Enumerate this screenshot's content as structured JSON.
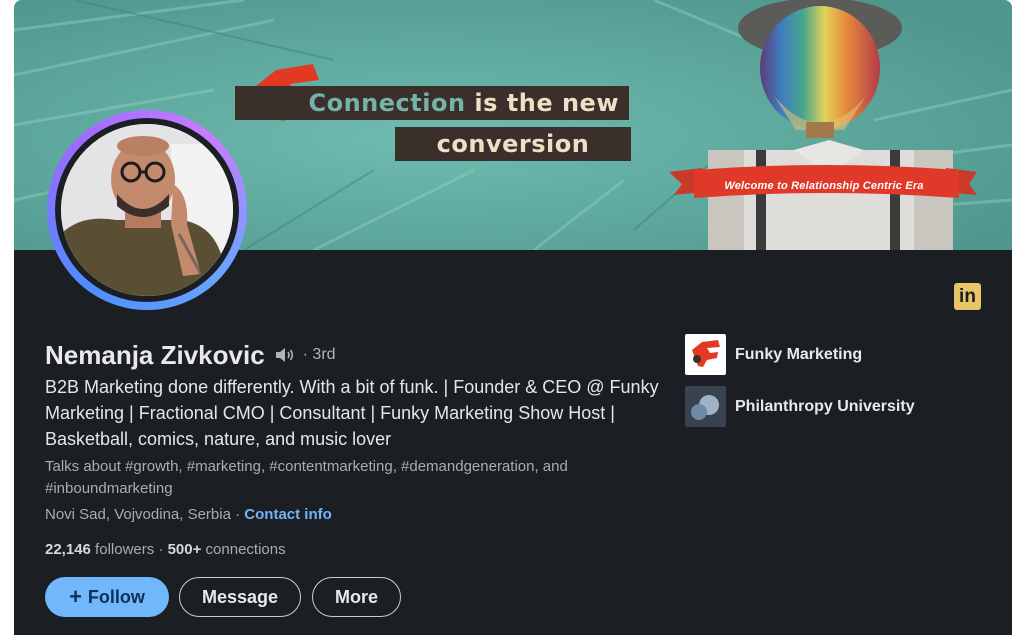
{
  "banner": {
    "headline_part1": "Connection",
    "headline_part2": " is the new",
    "headline_line2": "conversion",
    "ribbon_text": "Welcome to Relationship Centric Era"
  },
  "linkedin_badge": "in",
  "profile": {
    "name": "Nemanja Zivkovic",
    "degree": "· 3rd",
    "headline": "B2B Marketing done differently. With a bit of funk. | Founder & CEO @ Funky Marketing | Fractional CMO | Consultant | Funky Marketing Show Host | Basketball, comics, nature, and music lover",
    "talks_about": "Talks about #growth, #marketing, #contentmarketing, #demandgeneration, and #inboundmarketing",
    "location": "Novi Sad, Vojvodina, Serbia",
    "location_sep": " · ",
    "contact_info": "Contact info",
    "followers_count": "22,146",
    "followers_label": " followers",
    "connections_sep": " · ",
    "connections_count": "500+",
    "connections_label": " connections"
  },
  "actions": {
    "follow": "Follow",
    "message": "Message",
    "more": "More"
  },
  "organizations": [
    {
      "name": "Funky Marketing",
      "logo": "funky-marketing-logo"
    },
    {
      "name": "Philanthropy University",
      "logo": "philanthropy-university-logo"
    }
  ],
  "colors": {
    "card_bg": "#1b1f23",
    "banner_teal": "#5aa69b",
    "accent_blue": "#71b7fb",
    "link_blue": "#70b5f9",
    "brand_red": "#e23a22"
  }
}
